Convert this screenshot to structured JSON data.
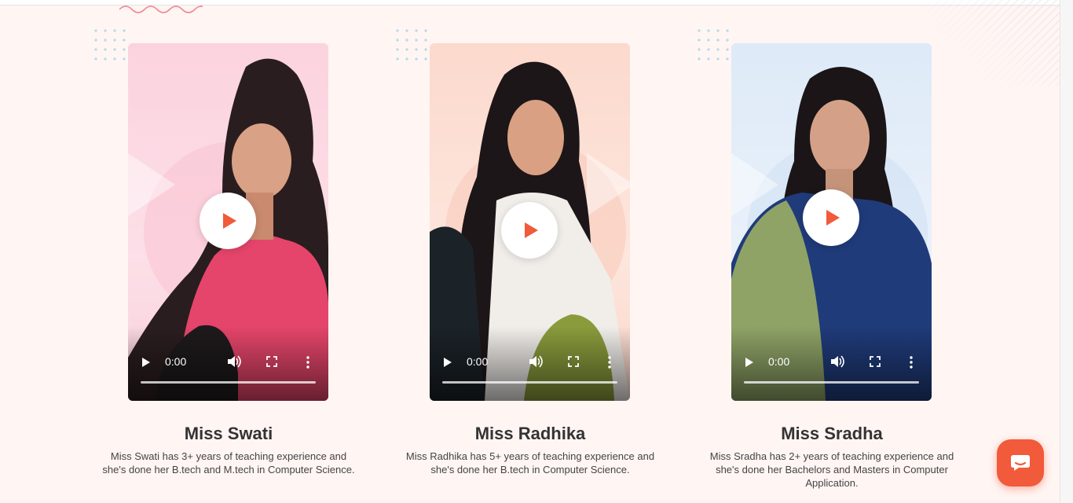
{
  "teachers": [
    {
      "name": "Miss Swati",
      "description": "Miss Swati has 3+ years of teaching experience and she's done her B.tech and M.tech in Computer Science.",
      "video_time": "0:00",
      "bg_color": "#fcdce6"
    },
    {
      "name": "Miss Radhika",
      "description": "Miss Radhika has 5+ years of teaching experience and she's done her B.tech in Computer Science.",
      "video_time": "0:00",
      "bg_color": "#fde4dc"
    },
    {
      "name": "Miss Sradha",
      "description": "Miss Sradha has 2+ years of teaching experience and she's done her Bachelors and Masters in Computer Application.",
      "video_time": "0:00",
      "bg_color": "#e3edf8"
    }
  ],
  "colors": {
    "accent": "#f15a3a",
    "page_background": "#fff5f3"
  },
  "icons": {
    "play": "play-icon",
    "volume": "volume-icon",
    "fullscreen": "fullscreen-icon",
    "more": "more-vertical-icon",
    "chat": "chat-icon"
  }
}
